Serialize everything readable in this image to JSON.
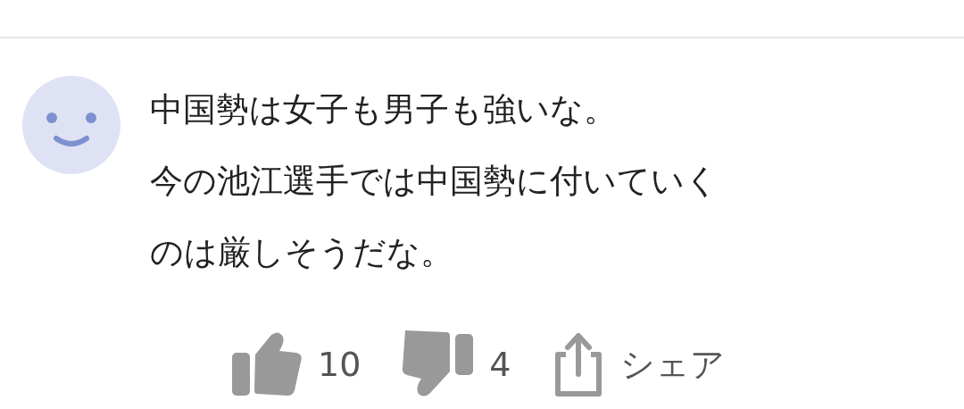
{
  "comment": {
    "lines": [
      "中国勢は女子も男子も強いな。",
      "今の池江選手では中国勢に付いていく",
      "のは厳しそうだな。"
    ],
    "actions": [
      {
        "kind": "like",
        "count": "10"
      },
      {
        "kind": "dislike",
        "count": "4"
      },
      {
        "kind": "share",
        "label": "シェア"
      }
    ]
  }
}
